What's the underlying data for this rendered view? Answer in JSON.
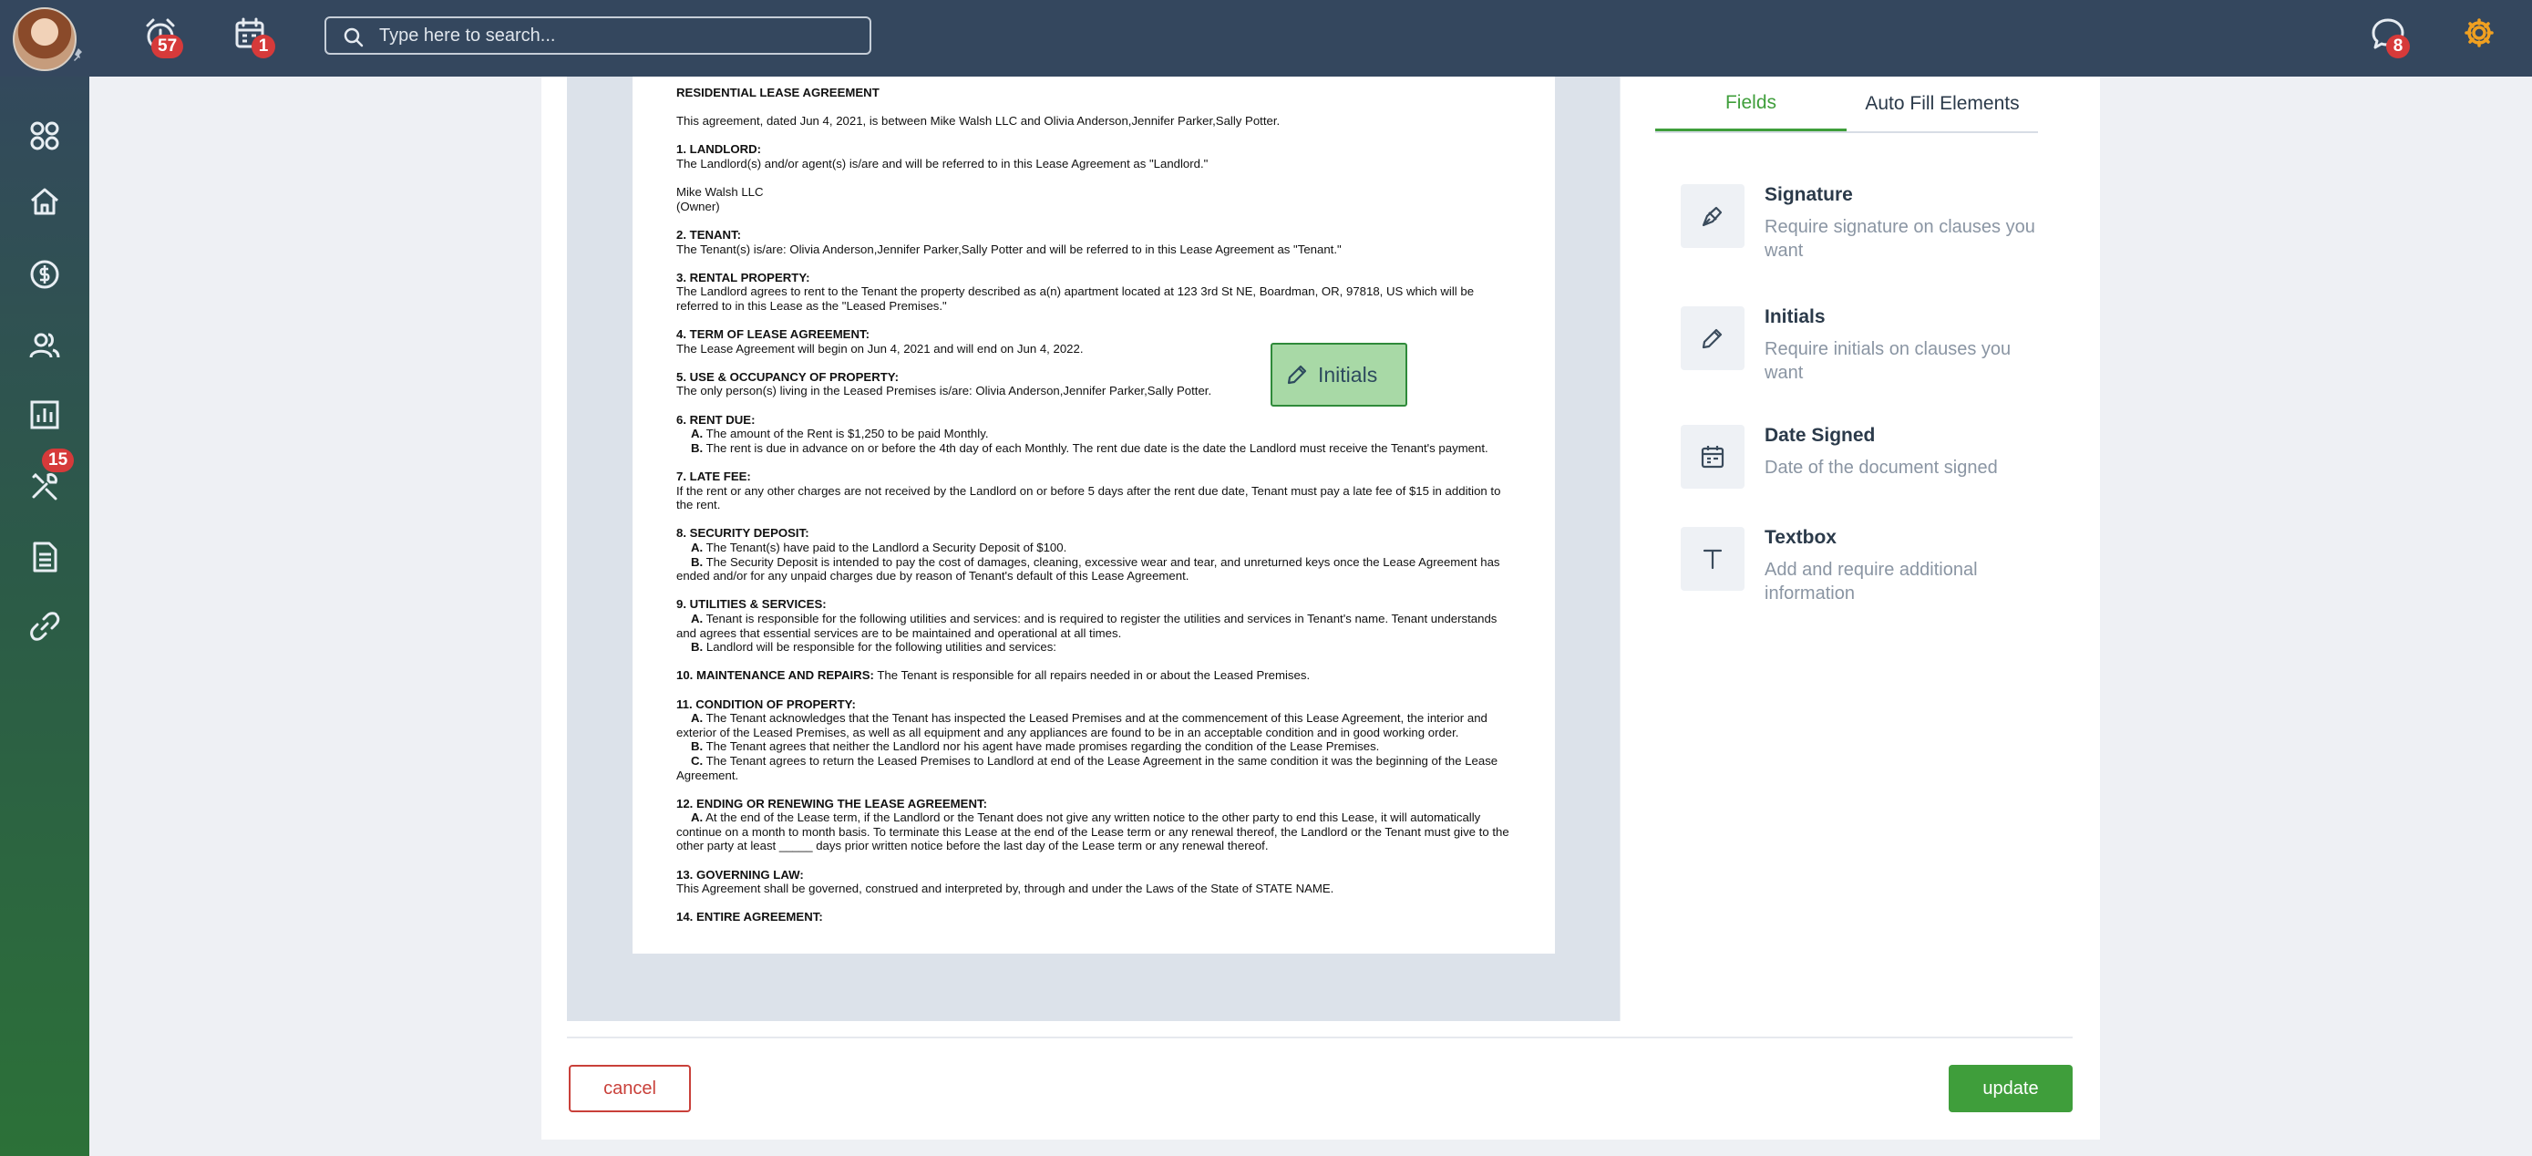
{
  "topbar": {
    "alarm_count": "57",
    "calendar_count": "1",
    "search_placeholder": "Type here to search...",
    "chat_count": "8"
  },
  "sidebar": {
    "items": [
      {
        "icon": "apps-grid-icon"
      },
      {
        "icon": "home-icon"
      },
      {
        "icon": "dollar-icon"
      },
      {
        "icon": "people-icon"
      },
      {
        "icon": "chart-icon"
      },
      {
        "icon": "tools-icon",
        "badge": "15"
      },
      {
        "icon": "document-icon"
      },
      {
        "icon": "link-icon"
      }
    ]
  },
  "document": {
    "title": "RESIDENTIAL LEASE AGREEMENT",
    "intro": "This agreement, dated Jun 4, 2021, is between Mike Walsh LLC and Olivia Anderson,Jennifer Parker,Sally Potter.",
    "s1_head": "1. LANDLORD:",
    "s1_body": "The Landlord(s) and/or agent(s) is/are and will be referred to in this Lease Agreement as \"Landlord.\"",
    "s1_name": "Mike Walsh LLC",
    "s1_role": "(Owner)",
    "s2_head": "2. TENANT:",
    "s2_body": "The Tenant(s) is/are: Olivia Anderson,Jennifer Parker,Sally Potter and will be referred to in this Lease Agreement as \"Tenant.\"",
    "s3_head": "3. RENTAL PROPERTY:",
    "s3_body": "The Landlord agrees to rent to the Tenant the property described as a(n) apartment located at 123 3rd St NE, Boardman, OR, 97818, US which will be referred to in this Lease as the \"Leased Premises.\"",
    "s4_head": "4. TERM OF LEASE AGREEMENT:",
    "s4_body": "The Lease Agreement will begin on Jun 4, 2021 and will end on Jun 4, 2022.",
    "s5_head": "5. USE & OCCUPANCY OF PROPERTY:",
    "s5_body": "The only person(s) living in the Leased Premises is/are: Olivia Anderson,Jennifer Parker,Sally Potter.",
    "s6_head": "6. RENT DUE:",
    "s6_a": "The amount of the Rent is $1,250 to be paid Monthly.",
    "s6_b": "The rent is due in advance on or before the 4th day of each Monthly. The rent due date is the date the Landlord must receive the Tenant's payment.",
    "s7_head": "7. LATE FEE:",
    "s7_body": "If the rent or any other charges are not received by the Landlord on or before 5 days after the rent due date, Tenant must pay a late fee of $15 in addition to the rent.",
    "s8_head": "8. SECURITY DEPOSIT:",
    "s8_a": "The Tenant(s) have paid to the Landlord a Security Deposit of $100.",
    "s8_b": "The Security Deposit is intended to pay the cost of damages, cleaning, excessive wear and tear, and unreturned keys once the Lease Agreement has ended and/or for any unpaid charges due by reason of Tenant's default of this Lease Agreement.",
    "s9_head": "9. UTILITIES & SERVICES:",
    "s9_a": "Tenant is responsible for the following utilities and services:  and is required to register the utilities and services in Tenant's name. Tenant understands and agrees that essential services are to be maintained and operational at all times.",
    "s9_b": "Landlord will be responsible for the following utilities and services:",
    "s10_head": "10. MAINTENANCE AND REPAIRS:",
    "s10_body": "The Tenant is responsible for all repairs needed in or about the Leased Premises.",
    "s11_head": "11. CONDITION OF PROPERTY:",
    "s11_a": "The Tenant acknowledges that the Tenant has inspected the Leased Premises and at the commencement of this Lease Agreement, the interior and exterior of the Leased Premises, as well as all equipment and any appliances are found to be in an acceptable condition and in good working order.",
    "s11_b": "The Tenant agrees that neither the Landlord nor his agent have made promises regarding the condition of the Lease Premises.",
    "s11_c": "The Tenant agrees to return the Leased Premises to Landlord at end of the Lease Agreement in the same condition it was the beginning of the Lease Agreement.",
    "s12_head": "12. ENDING OR RENEWING THE LEASE AGREEMENT:",
    "s12_a": "At the end of the Lease term, if the Landlord or the Tenant does not give any written notice to the other party to end this Lease, it will automatically continue on a month to month basis. To terminate this Lease at the end of the Lease term or any renewal thereof, the Landlord or the Tenant must give to the other party at least _____ days prior written notice before the last day of the Lease term or any renewal thereof.",
    "s13_head": "13. GOVERNING LAW:",
    "s13_body": "This Agreement shall be governed, construed and interpreted by, through and under the Laws of the State of STATE NAME.",
    "s14_head": "14. ENTIRE AGREEMENT:",
    "label_a": "A.",
    "label_b": "B.",
    "label_c": "C."
  },
  "placed_field": {
    "label": "Initials",
    "icon": "pencil-icon"
  },
  "panel": {
    "tabs": [
      "Fields",
      "Auto Fill Elements"
    ],
    "active_tab": "Fields",
    "fields": [
      {
        "icon": "signature-pen-icon",
        "title": "Signature",
        "desc": "Require signature on clauses you want"
      },
      {
        "icon": "pencil-icon",
        "title": "Initials",
        "desc": "Require initials on clauses you want"
      },
      {
        "icon": "calendar-icon",
        "title": "Date Signed",
        "desc": "Date of the document signed"
      },
      {
        "icon": "text-t-icon",
        "title": "Textbox",
        "desc": "Add and require additional information"
      }
    ]
  },
  "actions": {
    "cancel": "cancel",
    "update": "update"
  },
  "colors": {
    "topbar": "#34475e",
    "accent_green": "#3f9e3b",
    "cancel_red": "#c9403a",
    "badge_red": "#d63a3a",
    "settings_orange": "#f0a020"
  }
}
